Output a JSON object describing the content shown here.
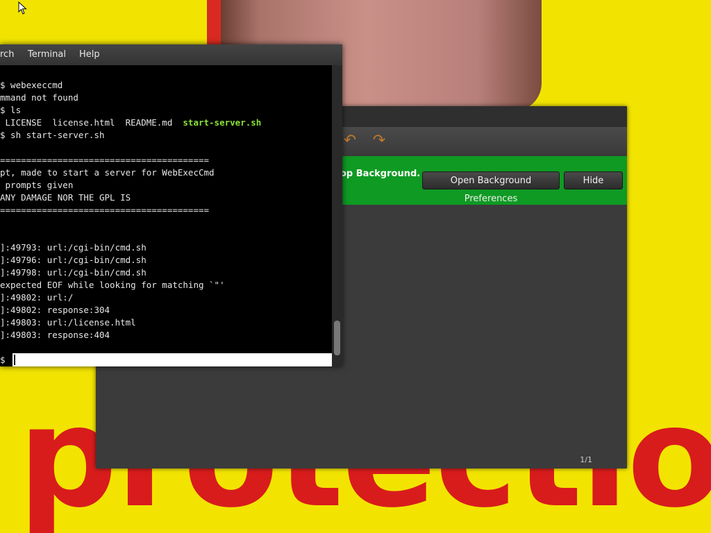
{
  "terminal": {
    "menus": [
      "rch",
      "Terminal",
      "Help"
    ],
    "lines": [
      {
        "text": "$ webexeccmd"
      },
      {
        "text": "mmand not found"
      },
      {
        "text": "$ ls"
      },
      {
        "text": " LICENSE  license.html  README.md  ",
        "highlight": "start-server.sh"
      },
      {
        "text": "$ sh start-server.sh"
      },
      {
        "text": ""
      },
      {
        "text": "========================================"
      },
      {
        "text": "pt, made to start a server for WebExecCmd"
      },
      {
        "text": " prompts given"
      },
      {
        "text": "ANY DAMAGE NOR THE GPL IS"
      },
      {
        "text": "========================================"
      },
      {
        "text": ""
      },
      {
        "text": ""
      },
      {
        "text": "]:49793: url:/cgi-bin/cmd.sh"
      },
      {
        "text": "]:49796: url:/cgi-bin/cmd.sh"
      },
      {
        "text": "]:49798: url:/cgi-bin/cmd.sh"
      },
      {
        "text": "expected EOF while looking for matching `\"'"
      },
      {
        "text": "]:49802: url:/"
      },
      {
        "text": "]:49802: response:304"
      },
      {
        "text": "]:49803: url:/license.html"
      },
      {
        "text": "]:49803: response:404"
      }
    ],
    "prompt": "$"
  },
  "app_window": {
    "infobar_text": "op Background.",
    "open_prefs_label": "Open Background Preferences",
    "hide_label": "Hide",
    "page_counter": "1/1",
    "infobar_color": "#0f9a23"
  },
  "wallpaper": {
    "word": "protection"
  },
  "icons": [
    "undo-icon",
    "redo-icon",
    "mouse-pointer-icon"
  ]
}
